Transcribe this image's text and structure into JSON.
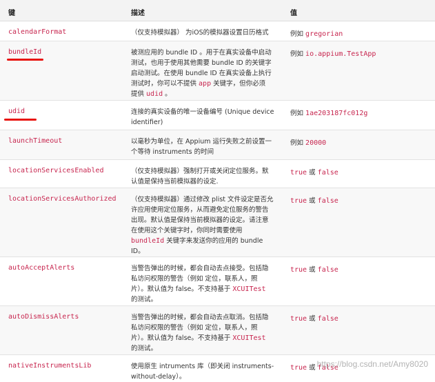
{
  "header": {
    "key": "键",
    "desc": "描述",
    "value": "值"
  },
  "rows": [
    {
      "key": "calendarFormat",
      "desc": [
        "（仅支持模拟器） 为iOS的模拟器设置日历格式"
      ],
      "value_prefix": "例如",
      "value_code": "gregorian"
    },
    {
      "key": "bundleId",
      "desc": [
        "被测应用的 bundle ID 。用于在真实设备中启动",
        "测试，也用于使用其他需要 bundle ID 的关键字",
        "启动测试。在使用 bundle ID 在真实设备上执行",
        "测试时，你可以不提供 ",
        "app",
        " 关键字，但你必须",
        "提供 ",
        "udid",
        " 。"
      ],
      "value_prefix": "例如",
      "value_code": "io.appium.TestApp"
    },
    {
      "key": "udid",
      "desc": [
        "连接的真实设备的唯一设备编号 (Unique device",
        "identifier)"
      ],
      "value_prefix": "例如",
      "value_code": "1ae203187fc012g"
    },
    {
      "key": "launchTimeout",
      "desc": [
        "以毫秒为单位，在 Appium 运行失败之前设置一",
        "个等待 instruments 的时间"
      ],
      "value_prefix": "例如",
      "value_code": "20000"
    },
    {
      "key": "locationServicesEnabled",
      "desc": [
        "（仅支持模拟器）强制打开或关闭定位服务。默",
        "认值是保持当前模拟器的设定."
      ],
      "value_code": "true",
      "value_mid": "或",
      "value_code2": "false"
    },
    {
      "key": "locationServicesAuthorized",
      "desc": [
        "（仅支持模拟器）通过修改 plist 文件设定是否允",
        "许应用使用定位服务，从而避免定位服务的警告",
        "出现。默认值是保持当前模拟器的设定。请注意",
        "在使用这个关键字时，你同时需要使用",
        "bundleId",
        " 关键字来发送你的应用的 bundle",
        "ID。"
      ],
      "value_code": "true",
      "value_mid": "或",
      "value_code2": "false"
    },
    {
      "key": "autoAcceptAlerts",
      "desc": [
        "当警告弹出的时候，都会自动去点接受。包括隐",
        "私访问权限的警告（例如 定位，联系人，照",
        "片）。默认值为 false。不支持基于 ",
        "XCUITest",
        "的测试。"
      ],
      "value_code": "true",
      "value_mid": "或",
      "value_code2": "false"
    },
    {
      "key": "autoDismissAlerts",
      "desc": [
        "当警告弹出的时候，都会自动去点取消。包括隐",
        "私访问权限的警告（例如 定位，联系人，照",
        "片）。默认值为 false。不支持基于 ",
        "XCUITest",
        "的测试。"
      ],
      "value_code": "true",
      "value_mid": "或",
      "value_code2": "false"
    },
    {
      "key": "nativeInstrumentsLib",
      "desc": [
        "使用原生 intruments 库（即关闭 instruments-",
        "without-delay）。"
      ],
      "value_code": "true",
      "value_mid": "或",
      "value_code2": "false"
    }
  ],
  "annotation_color": "#e8120c",
  "watermark": "https://blog.csdn.net/Amy8020"
}
